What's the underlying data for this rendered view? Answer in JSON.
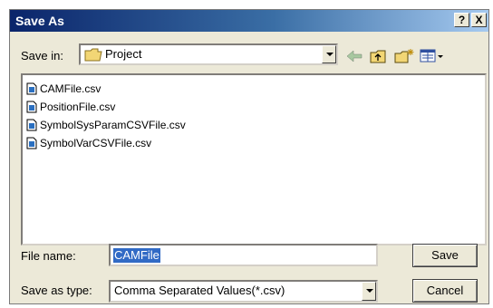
{
  "window": {
    "title": "Save As",
    "help_label": "?",
    "close_label": "X"
  },
  "save_in": {
    "label": "Save in:",
    "value": "Project"
  },
  "files": [
    {
      "name": "CAMFile.csv"
    },
    {
      "name": "PositionFile.csv"
    },
    {
      "name": "SymbolSysParamCSVFile.csv"
    },
    {
      "name": "SymbolVarCSVFile.csv"
    }
  ],
  "file_name": {
    "label": "File name:",
    "value": "CAMFile"
  },
  "save_as_type": {
    "label": "Save as type:",
    "value": "Comma Separated Values(*.csv)"
  },
  "buttons": {
    "save": "Save",
    "cancel": "Cancel"
  },
  "icons": [
    "back-arrow-icon",
    "up-folder-icon",
    "new-folder-icon",
    "view-menu-icon",
    "folder-icon",
    "file-icon"
  ],
  "colors": {
    "titlebar_start": "#0a246a",
    "titlebar_end": "#a6caf0",
    "selection": "#316ac5",
    "dialog_bg": "#ece9d8"
  }
}
